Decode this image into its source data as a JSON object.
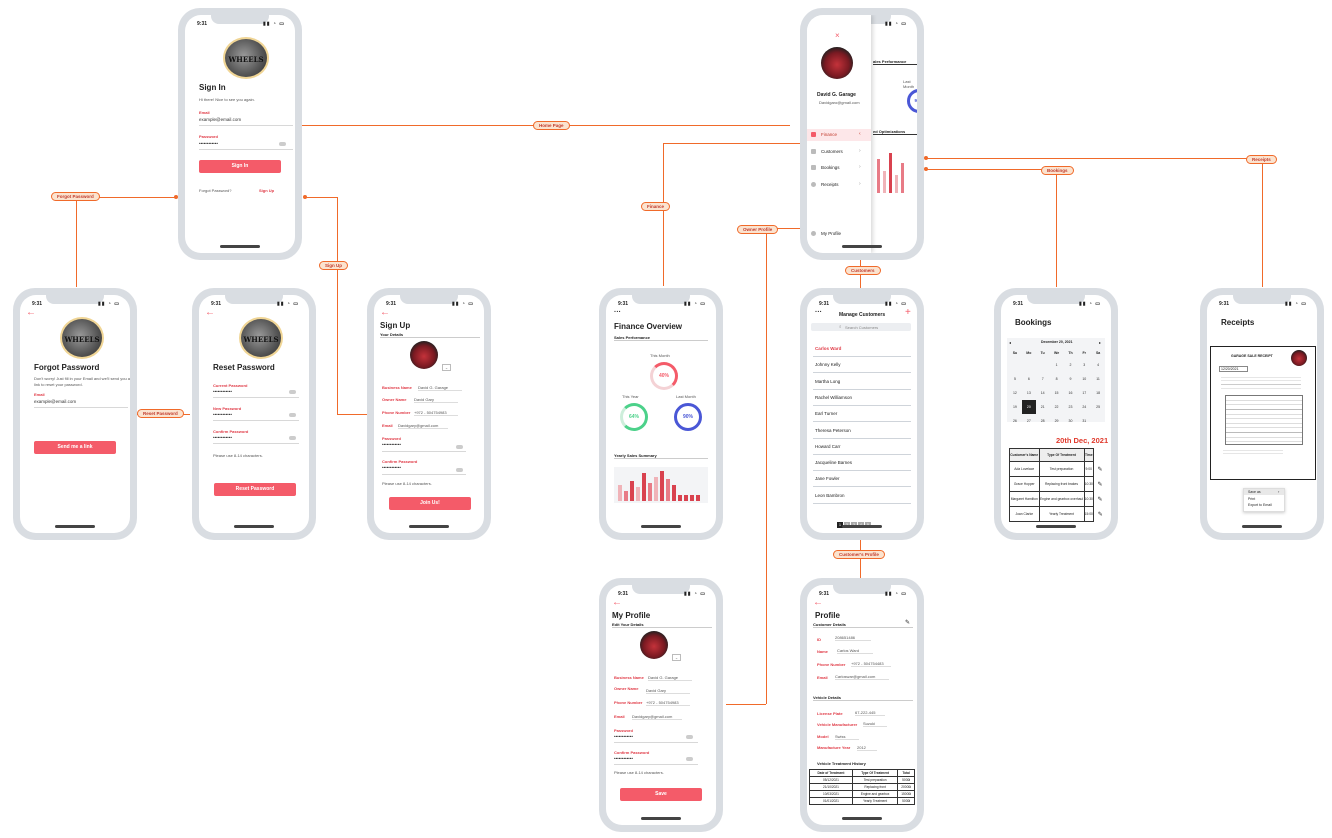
{
  "status_time": "9:31",
  "signin": {
    "logo_text": "WHEELS",
    "title": "Sign In",
    "subtitle": "Hi there! Nice to see you again.",
    "email_label": "Email",
    "email_value": "example@email.com",
    "password_label": "Password",
    "password_value": "••••••••••••",
    "button": "Sign In",
    "forgot": "Forgot Password?",
    "signup": "Sign Up"
  },
  "forgot": {
    "logo_text": "WHEELS",
    "title": "Forgot Password",
    "desc": "Don't worry! Just fill in your Email and we'll send you a link to reset your password.",
    "email_label": "Email",
    "email_value": "example@email.com",
    "button": "Send me a link"
  },
  "reset": {
    "logo_text": "WHEELS",
    "title": "Reset Password",
    "current_label": "Current Password",
    "new_label": "New Password",
    "confirm_label": "Confirm Password",
    "dots": "••••••••••••",
    "hint": "Please use 8-14 characters.",
    "button": "Reset Password"
  },
  "signup": {
    "title": "Sign Up",
    "section": "Your Details",
    "business_label": "Business Name",
    "business_value": "David G. Garage",
    "owner_label": "Owner Name",
    "owner_value": "David Gary",
    "phone_label": "Phone Number",
    "phone_value": "+972 - 504754983",
    "email_label": "Email",
    "email_value": "Davidgary@gmail.com",
    "password_label": "Password",
    "confirm_label": "Confirm Password",
    "dots": "••••••••••••",
    "hint": "Please use 8-14 characters.",
    "button": "Join Us!"
  },
  "drawer": {
    "close": "×",
    "name": "David G. Garage",
    "email": "Davidgaro@gmail.com",
    "items": [
      {
        "label": "Finance"
      },
      {
        "label": "Customers"
      },
      {
        "label": "Bookings"
      },
      {
        "label": "Receipts"
      }
    ],
    "profile": "My Profile",
    "behind_sales": "ales Performance",
    "behind_last": "Last Month",
    "behind_pct": "90%",
    "behind_opt": "ed Optimizations"
  },
  "finance": {
    "menu": "···",
    "title": "Finance Overview",
    "section": "Sales Performance",
    "this_month": "This Month",
    "this_month_pct": "40%",
    "this_year": "This Year",
    "this_year_pct": "64%",
    "last_month": "Last Month",
    "last_month_pct": "90%",
    "yearly": "Yearly Sales Summary"
  },
  "customers": {
    "menu": "···",
    "title": "Manage Customers",
    "add": "+",
    "search_placeholder": "Search Customers",
    "list": [
      "Carlos Ward",
      "Johnny Kelly",
      "Martha Long",
      "Rachel Williamson",
      "Earl Turner",
      "Theresa Peterson",
      "Howard Carr",
      "Jacqueline Barnes",
      "Jane Fowler",
      "Leon Bambron"
    ],
    "pages": [
      "1",
      "2",
      "3",
      "4",
      "5"
    ]
  },
  "bookings": {
    "title": "Bookings",
    "month": "December 20, 2021",
    "weekdays": [
      "Su",
      "Mo",
      "Tu",
      "We",
      "Th",
      "Fr",
      "Sa"
    ],
    "weeks": [
      [
        "",
        "",
        "",
        "1",
        "2",
        "3",
        "4"
      ],
      [
        "5",
        "6",
        "7",
        "8",
        "9",
        "10",
        "11"
      ],
      [
        "12",
        "13",
        "14",
        "15",
        "16",
        "17",
        "18"
      ],
      [
        "19",
        "20",
        "21",
        "22",
        "23",
        "24",
        "25"
      ],
      [
        "26",
        "27",
        "28",
        "29",
        "30",
        "31",
        ""
      ]
    ],
    "selected": "20",
    "big_date": "20th Dec, 2021",
    "headers": [
      "Customer's Name",
      "Type Of Treatment",
      "Time"
    ],
    "rows": [
      [
        "Ada Lovelace",
        "Test preparation",
        "9:00"
      ],
      [
        "Grace Hopper",
        "Replacing front brakes",
        "10:30"
      ],
      [
        "Margaret Hamilton",
        "Engine and gearbox overhaul",
        "10:30"
      ],
      [
        "Joan Clarke",
        "Yearly Treatment",
        "15:00"
      ]
    ]
  },
  "receipts": {
    "title": "Receipts",
    "doc_title": "GARAGE SALE RECEIPT",
    "doc_date": "12/20/2021",
    "menu": [
      "Save as",
      "Print",
      "Export to Email"
    ]
  },
  "myprofile": {
    "title": "My Profile",
    "section": "Edit Your Details",
    "business_label": "Business Name",
    "business_value": "David G. Garage",
    "owner_label": "Owner Name",
    "owner_value": "David Gary",
    "phone_label": "Phone Number",
    "phone_value": "+972 - 504754983",
    "email_label": "Email",
    "email_value": "Davidgary@gmail.com",
    "password_label": "Password",
    "confirm_label": "Confirm Password",
    "dots": "••••••••••••",
    "hint": "Please use 8-14 characters.",
    "button": "Save"
  },
  "custprofile": {
    "title": "Profile",
    "section1": "Customer Details",
    "id_label": "ID",
    "id_value": "208651486",
    "name_label": "Name",
    "name_value": "Carlos Ward",
    "phone_label": "Phone Number",
    "phone_value": "+972 - 504754483",
    "email_label": "Email",
    "email_value": "Carloswar@gmail.com",
    "section2": "Vehicle Details",
    "plate_label": "License Plate",
    "plate_value": "67-222-445",
    "maker_label": "Vehicle Manufacturer",
    "maker_value": "Suzuki",
    "model_label": "Model",
    "model_value": "Swiss",
    "year_label": "Manufacture Year",
    "year_value": "2012",
    "section3": "Vehicle Treatment History",
    "headers": [
      "Date of Treatment",
      "Type Of Treatment",
      "Total"
    ],
    "rows": [
      [
        "05/12/2021",
        "Test preparation",
        "500₪"
      ],
      [
        "21/10/2021",
        "Replacing front",
        "2000₪"
      ],
      [
        "10/03/2021",
        "Engine and gearbox",
        "1500₪"
      ],
      [
        "01/01/2021",
        "Yearly Treatment",
        "500₪"
      ]
    ]
  },
  "flow_labels": {
    "home": "Home Page",
    "forgot": "Forgot Password",
    "reset": "Reset Password",
    "signup": "Sign Up",
    "finance": "Finance",
    "owner": "Owner Profile",
    "customers": "Customers",
    "bookings": "Bookings",
    "receipts": "Receipts",
    "custprofile": "Customer's Profile"
  },
  "colors": {
    "accent": "#f45b69",
    "flow": "#f06a2a",
    "frame": "#d9dde2"
  }
}
